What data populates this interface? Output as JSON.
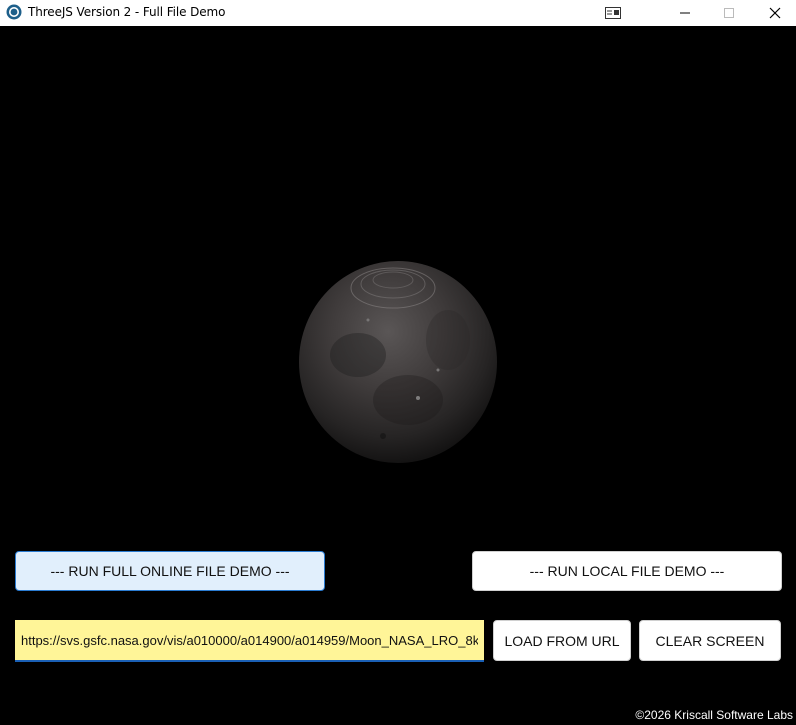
{
  "window": {
    "title": "ThreeJS Version 2 - Full File Demo",
    "icons": {
      "app": "app-logo-icon",
      "extra": "snap-layout-icon",
      "minimize": "minimize-icon",
      "maximize": "maximize-icon",
      "close": "close-icon"
    }
  },
  "scene": {
    "object": "moon",
    "background_color": "#000000"
  },
  "controls": {
    "online_demo_label": "--- RUN FULL ONLINE FILE DEMO ---",
    "local_demo_label": "--- RUN LOCAL FILE DEMO ---",
    "url_value": "https://svs.gsfc.nasa.gov/vis/a010000/a014900/a014959/Moon_NASA_LRO_8k_",
    "load_label": "LOAD FROM URL",
    "clear_label": "CLEAR SCREEN"
  },
  "footer": {
    "copyright": "©2026 Kriscall Software Labs"
  },
  "colors": {
    "accent": "#2a7bd1",
    "input_bg": "#fff598",
    "selected_button_bg": "#e1effc"
  }
}
